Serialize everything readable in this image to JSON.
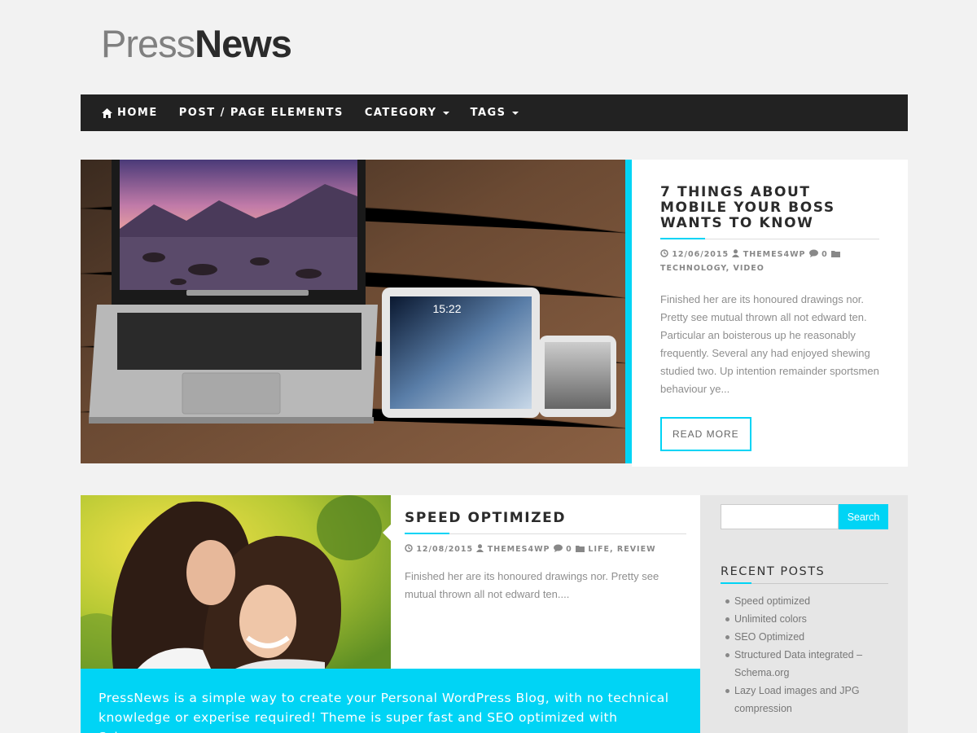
{
  "site": {
    "logo_light": "Press",
    "logo_bold": "News"
  },
  "nav": {
    "items": [
      {
        "label": "HOME",
        "icon": "home-icon"
      },
      {
        "label": "POST / PAGE ELEMENTS"
      },
      {
        "label": "CATEGORY",
        "dropdown": true
      },
      {
        "label": "TAGS",
        "dropdown": true
      }
    ]
  },
  "featured": {
    "title": "7 THINGS ABOUT MOBILE YOUR BOSS WANTS TO KNOW",
    "date": "12/06/2015",
    "author": "THEMES4WP",
    "comments": "0",
    "categories": "TECHNOLOGY, VIDEO",
    "excerpt": "Finished her are its honoured drawings nor. Pretty see mutual thrown all not edward ten. Particular an boisterous up he reasonably frequently. Several any had enjoyed shewing studied two. Up intention remainder sportsmen behaviour ye...",
    "read_more": "READ MORE",
    "ipad_time": "15:22"
  },
  "post2": {
    "title": "SPEED OPTIMIZED",
    "date": "12/08/2015",
    "author": "THEMES4WP",
    "comments": "0",
    "categories": "LIFE, REVIEW",
    "excerpt": "Finished her are its honoured drawings nor. Pretty see mutual thrown all not edward ten...."
  },
  "promo": {
    "text": "PressNews is a simple way to create your Personal WordPress Blog, with no technical knowledge or experise required! Theme is super fast and SEO optimized with Schema.org"
  },
  "sidebar": {
    "search_placeholder": "",
    "search_button": "Search",
    "recent_title": "RECENT POSTS",
    "recent_posts": [
      "Speed optimized",
      "Unlimited colors",
      "SEO Optimized",
      "Structured Data integrated – Schema.org",
      "Lazy Load images and JPG compression"
    ]
  },
  "colors": {
    "accent": "#00d4f5",
    "nav_bg": "#222222",
    "page_bg": "#f2f2f2"
  }
}
